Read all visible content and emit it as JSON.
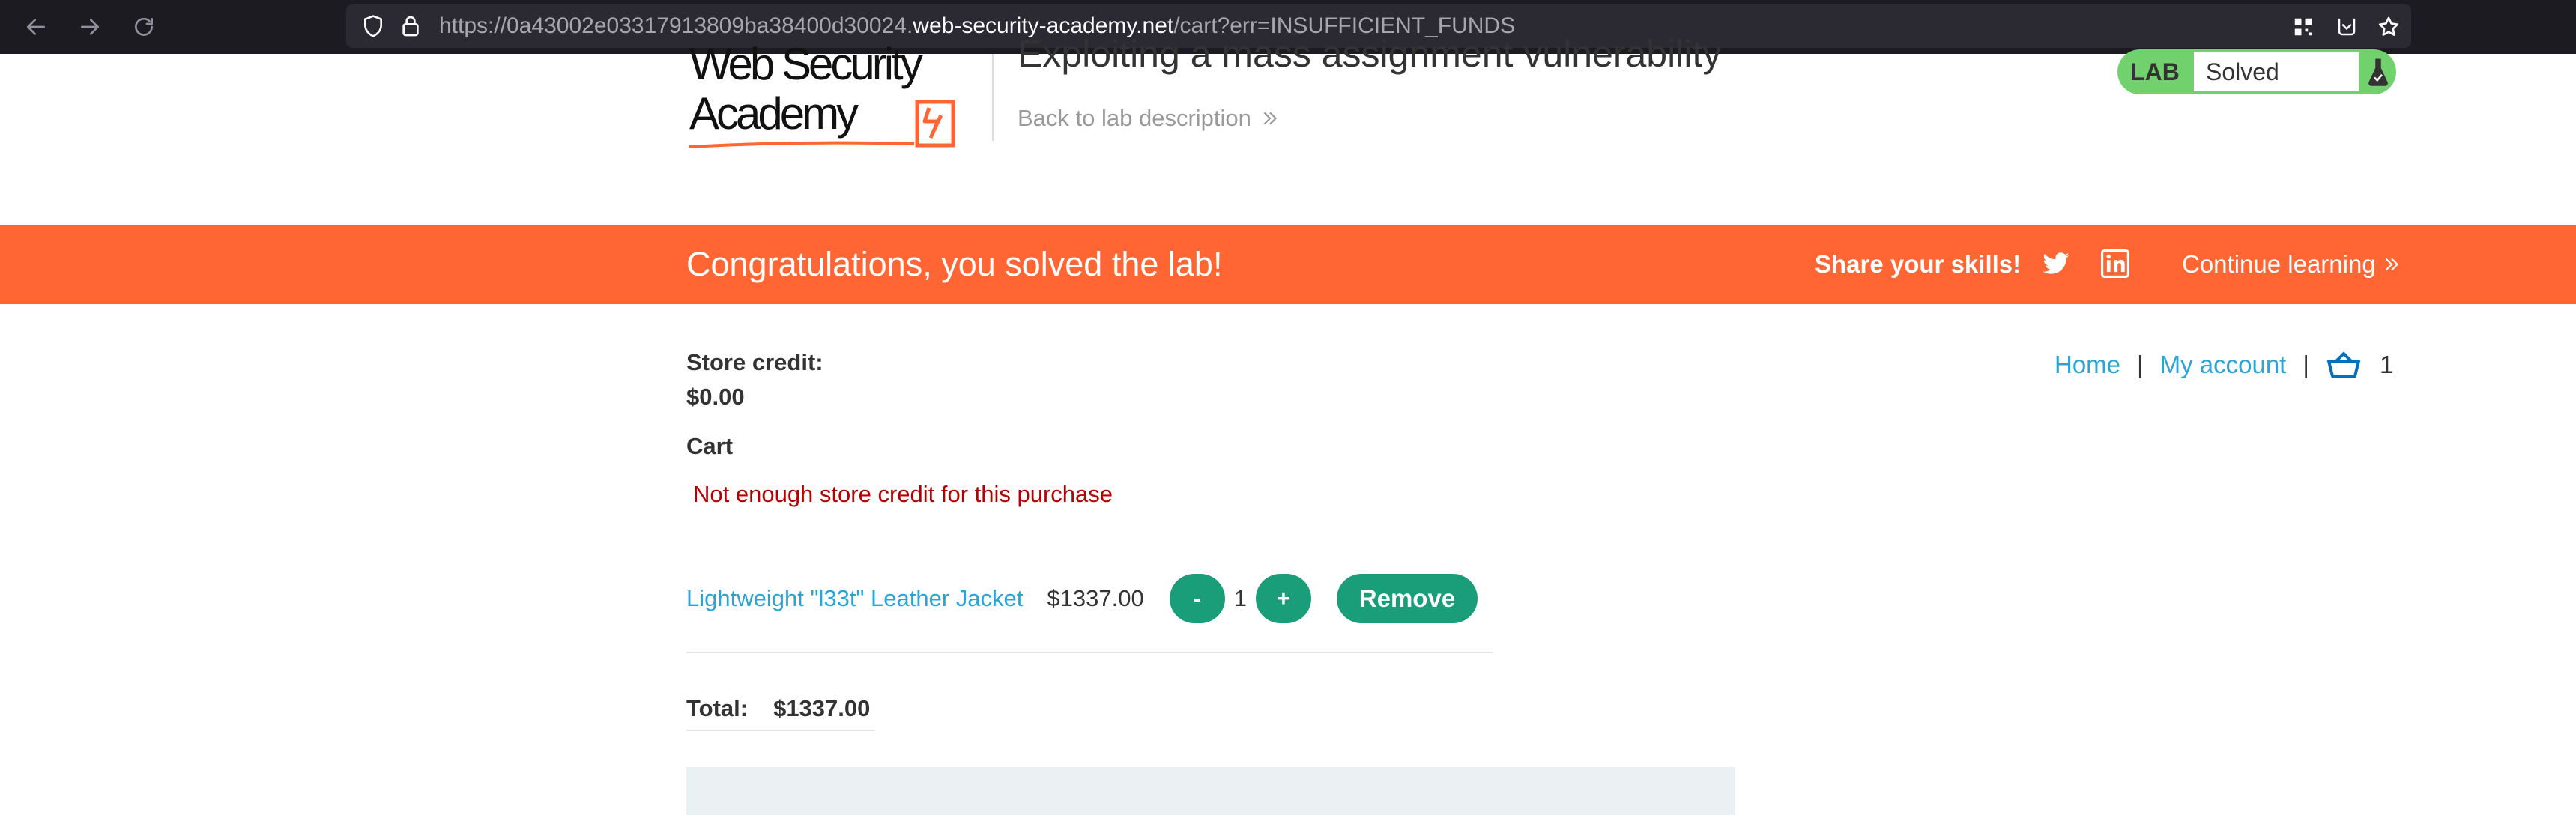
{
  "browser": {
    "url_prefix": "https://0a43002e03317913809ba38400d30024.",
    "url_host": "web-security-academy.net",
    "url_path": "/cart?err=INSUFFICIENT_FUNDS"
  },
  "header": {
    "logo_line1": "Web Security",
    "logo_line2": "Academy",
    "lab_title": "Exploiting a mass assignment vulnerability",
    "back_link": "Back to lab description",
    "lab_tag": "LAB",
    "lab_status": "Solved"
  },
  "banner": {
    "message": "Congratulations, you solved the lab!",
    "share": "Share your skills!",
    "continue": "Continue learning"
  },
  "nav": {
    "home": "Home",
    "my_account": "My account",
    "separator": "|",
    "cart_count": "1"
  },
  "account": {
    "credit_label": "Store credit:",
    "credit_value": "$0.00"
  },
  "cart": {
    "heading": "Cart",
    "error": "Not enough store credit for this purchase",
    "item": {
      "name": "Lightweight \"l33t\" Leather Jacket",
      "price": "$1337.00",
      "quantity": "1",
      "minus_label": "-",
      "plus_label": "+",
      "remove_label": "Remove"
    },
    "total_label": "Total:",
    "total_value": "$1337.00"
  },
  "colors": {
    "banner": "#ff6633",
    "button": "#1a9d79",
    "link": "#29a4d8",
    "error": "#b50000",
    "lab_solved": "#70d16d"
  }
}
